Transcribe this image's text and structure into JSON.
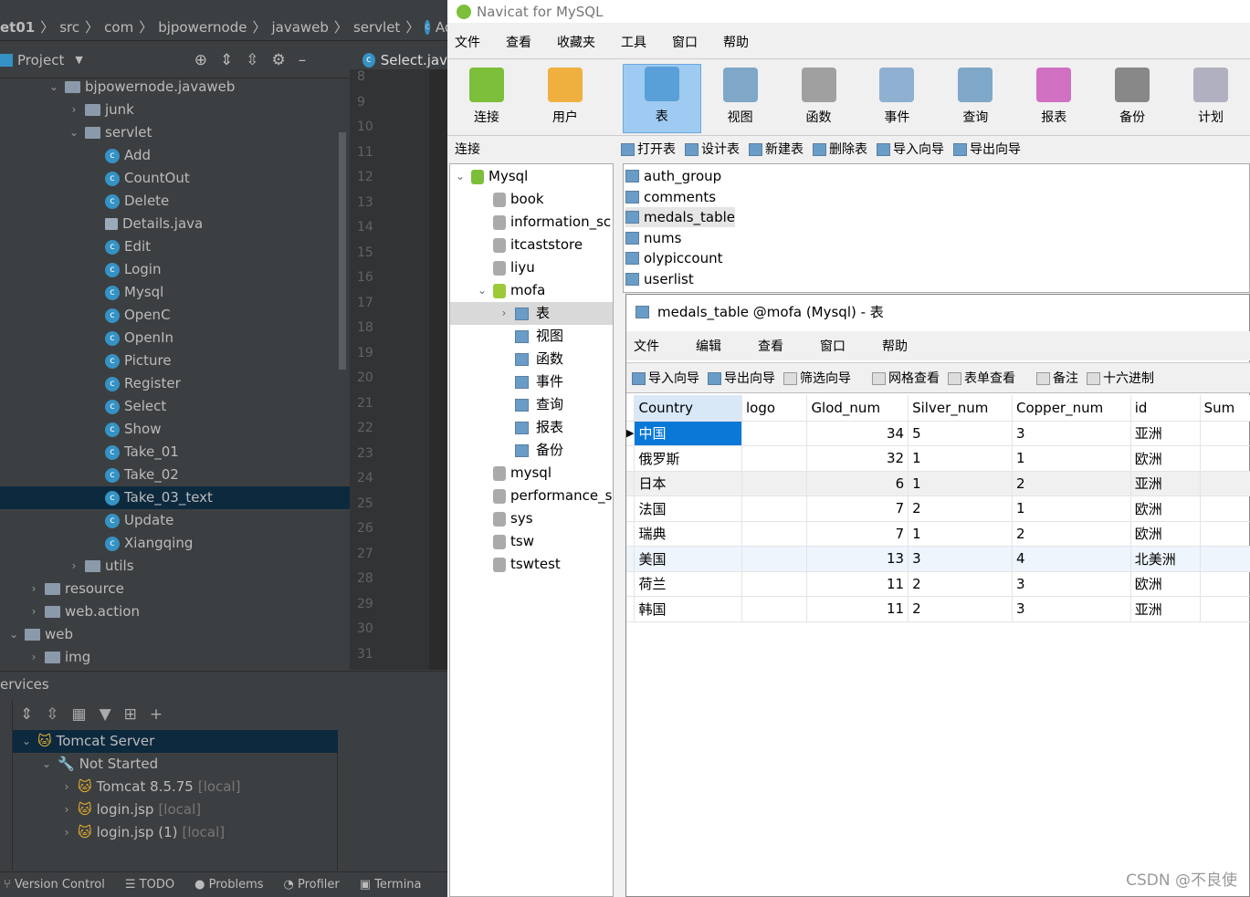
{
  "ide": {
    "breadcrumb": [
      "et01",
      "src",
      "com",
      "bjpowernode",
      "javaweb",
      "servlet",
      "Add"
    ],
    "project_label": "Project",
    "editor_tab": "Select.jav",
    "tree": [
      {
        "label": "bjpowernode.javaweb",
        "type": "package",
        "depth": 2,
        "expanded": true
      },
      {
        "label": "junk",
        "type": "folder",
        "depth": 3,
        "expanded": false
      },
      {
        "label": "servlet",
        "type": "folder",
        "depth": 3,
        "expanded": true
      },
      {
        "label": "Add",
        "type": "class",
        "depth": 4
      },
      {
        "label": "CountOut",
        "type": "class",
        "depth": 4
      },
      {
        "label": "Delete",
        "type": "class",
        "depth": 4
      },
      {
        "label": "Details.java",
        "type": "file",
        "depth": 4
      },
      {
        "label": "Edit",
        "type": "class",
        "depth": 4
      },
      {
        "label": "Login",
        "type": "class",
        "depth": 4
      },
      {
        "label": "Mysql",
        "type": "class",
        "depth": 4
      },
      {
        "label": "OpenC",
        "type": "class",
        "depth": 4
      },
      {
        "label": "OpenIn",
        "type": "class",
        "depth": 4
      },
      {
        "label": "Picture",
        "type": "class",
        "depth": 4
      },
      {
        "label": "Register",
        "type": "class",
        "depth": 4
      },
      {
        "label": "Select",
        "type": "class",
        "depth": 4
      },
      {
        "label": "Show",
        "type": "class",
        "depth": 4
      },
      {
        "label": "Take_01",
        "type": "class",
        "depth": 4
      },
      {
        "label": "Take_02",
        "type": "class",
        "depth": 4
      },
      {
        "label": "Take_03_text",
        "type": "class",
        "depth": 4,
        "selected": true
      },
      {
        "label": "Update",
        "type": "class",
        "depth": 4
      },
      {
        "label": "Xiangqing",
        "type": "class",
        "depth": 4
      },
      {
        "label": "utils",
        "type": "folder",
        "depth": 3,
        "expanded": false
      },
      {
        "label": "resource",
        "type": "folder",
        "depth": 1,
        "expanded": false
      },
      {
        "label": "web.action",
        "type": "folder",
        "depth": 1,
        "expanded": false
      },
      {
        "label": "web",
        "type": "folder",
        "depth": 0,
        "expanded": true
      },
      {
        "label": "img",
        "type": "folder",
        "depth": 1,
        "expanded": false
      }
    ],
    "line_numbers": [
      "8",
      "9",
      "10",
      "11",
      "12",
      "13",
      "14",
      "15",
      "16",
      "17",
      "18",
      "19",
      "20",
      "21",
      "22",
      "23",
      "24",
      "25",
      "26",
      "27",
      "28",
      "29",
      "30",
      "31"
    ],
    "services_title": "ervices",
    "services_tree": [
      {
        "label": "Tomcat Server",
        "suffix": "",
        "depth": 0,
        "icon": "tomcat-icon",
        "selected": true
      },
      {
        "label": "Not Started",
        "suffix": "",
        "depth": 1,
        "icon": "wrench-icon"
      },
      {
        "label": "Tomcat 8.5.75",
        "suffix": "[local]",
        "depth": 2,
        "icon": "tomcat-icon"
      },
      {
        "label": "login.jsp",
        "suffix": "[local]",
        "depth": 2,
        "icon": "tomcat-icon"
      },
      {
        "label": "login.jsp (1)",
        "suffix": "[local]",
        "depth": 2,
        "icon": "tomcat-icon"
      }
    ],
    "status_bar": [
      "Version Control",
      "TODO",
      "Problems",
      "Profiler",
      "Termina"
    ]
  },
  "navicat": {
    "title": "Navicat for MySQL",
    "menu": [
      "文件",
      "查看",
      "收藏夹",
      "工具",
      "窗口",
      "帮助"
    ],
    "toolbar": [
      {
        "label": "连接",
        "color": "#7bbf3a"
      },
      {
        "label": "用户",
        "color": "#f0b040"
      },
      {
        "label": "表",
        "color": "#5aa0d8",
        "selected": true
      },
      {
        "label": "视图",
        "color": "#7fa8c8"
      },
      {
        "label": "函数",
        "color": "#a0a0a0"
      },
      {
        "label": "事件",
        "color": "#8fb0d0"
      },
      {
        "label": "查询",
        "color": "#7fa8c8"
      },
      {
        "label": "报表",
        "color": "#d070c0"
      },
      {
        "label": "备份",
        "color": "#888888"
      },
      {
        "label": "计划",
        "color": "#b0b0c0"
      }
    ],
    "conn_label": "连接",
    "sub_toolbar": [
      "打开表",
      "设计表",
      "新建表",
      "删除表",
      "导入向导",
      "导出向导"
    ],
    "conn_tree": [
      {
        "label": "Mysql",
        "depth": 0,
        "expanded": true
      },
      {
        "label": "book",
        "depth": 1
      },
      {
        "label": "information_sc",
        "depth": 1
      },
      {
        "label": "itcaststore",
        "depth": 1
      },
      {
        "label": "liyu",
        "depth": 1
      },
      {
        "label": "mofa",
        "depth": 1,
        "expanded": true
      },
      {
        "label": "表",
        "depth": 2,
        "selected": true
      },
      {
        "label": "视图",
        "depth": 2
      },
      {
        "label": "函数",
        "depth": 2
      },
      {
        "label": "事件",
        "depth": 2
      },
      {
        "label": "查询",
        "depth": 2
      },
      {
        "label": "报表",
        "depth": 2
      },
      {
        "label": "备份",
        "depth": 2
      },
      {
        "label": "mysql",
        "depth": 1
      },
      {
        "label": "performance_s",
        "depth": 1
      },
      {
        "label": "sys",
        "depth": 1
      },
      {
        "label": "tsw",
        "depth": 1
      },
      {
        "label": "tswtest",
        "depth": 1
      }
    ],
    "tables": [
      "auth_group",
      "comments",
      "medals_table",
      "nums",
      "olypiccount",
      "userlist"
    ],
    "selected_table": "medals_table",
    "window": {
      "title": "medals_table @mofa (Mysql) - 表",
      "menu": [
        "文件",
        "编辑",
        "查看",
        "窗口",
        "帮助"
      ],
      "toolbar": [
        "导入向导",
        "导出向导",
        "筛选向导",
        "网格查看",
        "表单查看",
        "备注",
        "十六进制"
      ],
      "columns": [
        "Country",
        "logo",
        "Glod_num",
        "Silver_num",
        "Copper_num",
        "id",
        "Sum"
      ],
      "rows": [
        [
          "中国",
          "",
          "34",
          "5",
          "3",
          "亚洲",
          ""
        ],
        [
          "俄罗斯",
          "",
          "32",
          "1",
          "1",
          "欧洲",
          ""
        ],
        [
          "日本",
          "",
          "6",
          "1",
          "2",
          "亚洲",
          ""
        ],
        [
          "法国",
          "",
          "7",
          "2",
          "1",
          "欧洲",
          ""
        ],
        [
          "瑞典",
          "",
          "7",
          "1",
          "2",
          "欧洲",
          ""
        ],
        [
          "美国",
          "",
          "13",
          "3",
          "4",
          "北美洲",
          ""
        ],
        [
          "荷兰",
          "",
          "11",
          "2",
          "3",
          "欧洲",
          ""
        ],
        [
          "韩国",
          "",
          "11",
          "2",
          "3",
          "亚洲",
          ""
        ]
      ]
    }
  },
  "watermark": "CSDN @不良使"
}
